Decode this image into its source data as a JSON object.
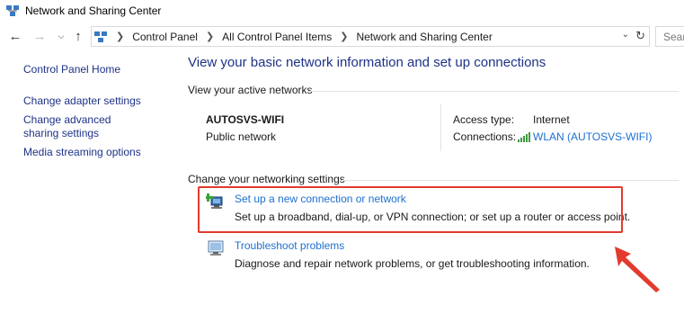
{
  "window": {
    "title": "Network and Sharing Center"
  },
  "navigation": {
    "back_icon": "arrow-left-icon",
    "forward_icon": "arrow-right-icon",
    "recent_icon": "chevron-down-icon",
    "up_icon": "arrow-up-icon",
    "breadcrumb": [
      "Control Panel",
      "All Control Panel Items",
      "Network and Sharing Center"
    ],
    "search_placeholder": "Sear"
  },
  "sidebar": {
    "items": [
      {
        "label": "Control Panel Home"
      },
      {
        "label": "Change adapter settings"
      },
      {
        "label": "Change advanced sharing settings"
      },
      {
        "label": "Media streaming options"
      }
    ]
  },
  "main": {
    "title": "View your basic network information and set up connections",
    "active_networks_heading": "View your active networks",
    "network": {
      "name": "AUTOSVS-WIFI",
      "category": "Public network",
      "access_type_label": "Access type:",
      "access_type_value": "Internet",
      "connections_label": "Connections:",
      "connection_link": "WLAN (AUTOSVS-WIFI)"
    },
    "settings_heading": "Change your networking settings",
    "tasks": [
      {
        "link": "Set up a new connection or network",
        "description": "Set up a broadband, dial-up, or VPN connection; or set up a router or access point."
      },
      {
        "link": "Troubleshoot problems",
        "description": "Diagnose and repair network problems, or get troubleshooting information."
      }
    ]
  },
  "annotation": {
    "highlight_color": "#e23b2e"
  }
}
